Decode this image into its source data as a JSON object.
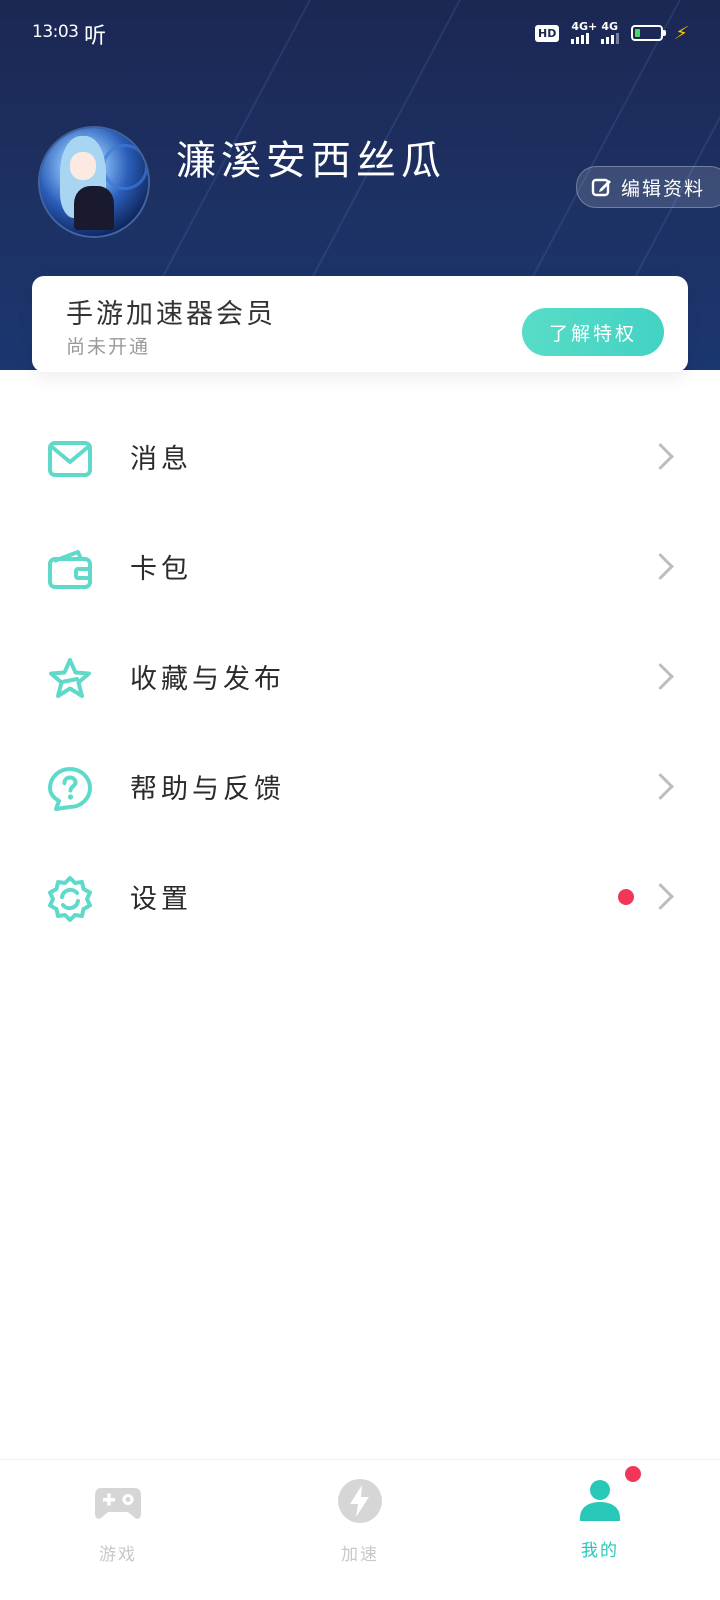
{
  "status_bar": {
    "time": "13:03",
    "app_indicator": "听",
    "hd": "HD",
    "net1": "4G+",
    "net2": "4G"
  },
  "profile": {
    "username": "濂溪安西丝瓜",
    "edit_label": "编辑资料"
  },
  "vip": {
    "title": "手游加速器会员",
    "status": "尚未开通",
    "button_label": "了解特权"
  },
  "menu": {
    "items": [
      {
        "label": "消息",
        "icon": "mail-icon"
      },
      {
        "label": "卡包",
        "icon": "wallet-icon"
      },
      {
        "label": "收藏与发布",
        "icon": "star-icon"
      },
      {
        "label": "帮助与反馈",
        "icon": "help-icon"
      },
      {
        "label": "设置",
        "icon": "settings-icon",
        "badge": "red-dot"
      }
    ]
  },
  "bottom_nav": {
    "tabs": [
      {
        "label": "游戏",
        "icon": "gamepad-icon",
        "active": false
      },
      {
        "label": "加速",
        "icon": "bolt-icon",
        "active": false
      },
      {
        "label": "我的",
        "icon": "user-icon",
        "active": true,
        "badge": "red-dot"
      }
    ]
  },
  "colors": {
    "header_bg": "#1c2753",
    "accent": "#43d2c3",
    "badge": "#f0375a",
    "inactive": "#c8c8c8"
  }
}
